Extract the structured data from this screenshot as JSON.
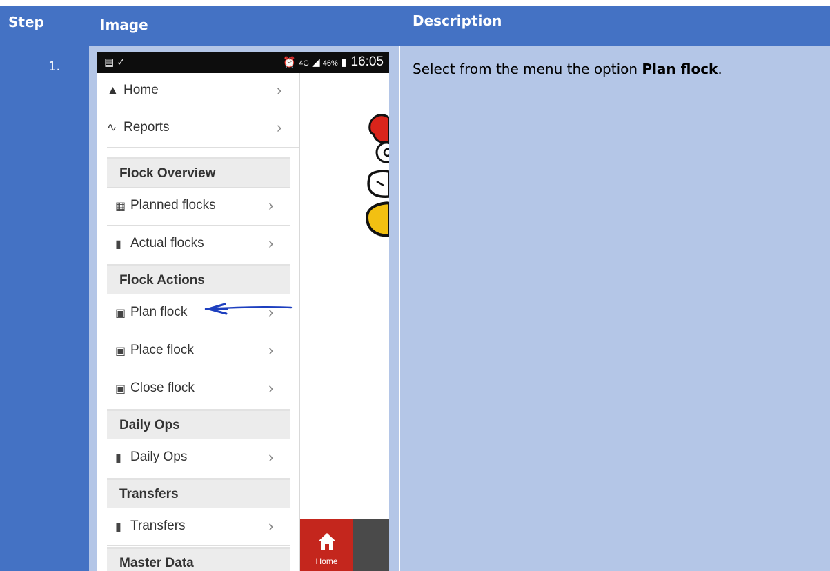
{
  "table": {
    "headers": {
      "step": "Step",
      "image": "Image",
      "description": "Description"
    },
    "rows": [
      {
        "step": "1.",
        "description_prefix": "Select from the menu the option ",
        "description_bold": "Plan flock",
        "description_suffix": "."
      }
    ]
  },
  "phone": {
    "status": {
      "left_icons": "notification-icons",
      "network": "4G",
      "battery": "46%",
      "time": "16:05"
    },
    "menu": [
      {
        "icon": "home-icon",
        "label": "Home"
      },
      {
        "icon": "activity-icon",
        "label": "Reports"
      }
    ],
    "sections": [
      {
        "title": "Flock Overview",
        "items": [
          {
            "icon": "calendar-icon",
            "label": "Planned flocks"
          },
          {
            "icon": "book-icon",
            "label": "Actual flocks"
          }
        ]
      },
      {
        "title": "Flock Actions",
        "items": [
          {
            "icon": "cart-icon",
            "label": "Plan flock"
          },
          {
            "icon": "cart-icon",
            "label": "Place flock"
          },
          {
            "icon": "cart-icon",
            "label": "Close flock"
          }
        ]
      },
      {
        "title": "Daily Ops",
        "items": [
          {
            "icon": "book-icon",
            "label": "Daily Ops"
          }
        ]
      },
      {
        "title": "Transfers",
        "items": [
          {
            "icon": "book-icon",
            "label": "Transfers"
          }
        ]
      },
      {
        "title": "Master Data",
        "items": []
      }
    ],
    "bottom_nav": {
      "home_label": "Home"
    },
    "annotation_color": "#1d3fbf",
    "accent_red": "#c4261d"
  }
}
